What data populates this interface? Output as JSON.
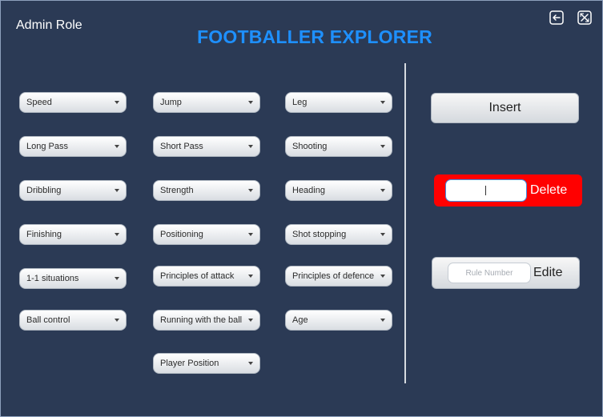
{
  "header": {
    "role_label": "Admin Role",
    "app_title": "FOOTBALLER EXPLORER"
  },
  "colors": {
    "background": "#2b3a55",
    "title": "#1e90ff",
    "delete_panel": "#ff0000"
  },
  "window_controls": {
    "logout_icon": "logout-icon",
    "close_icon": "close-x-icon"
  },
  "attributes": {
    "speed": "Speed",
    "jump": "Jump",
    "leg": "Leg",
    "long_pass": "Long Pass",
    "short_pass": "Short Pass",
    "shooting": "Shooting",
    "dribbling": "Dribbling",
    "strength": "Strength",
    "heading": "Heading",
    "finishing": "Finishing",
    "positioning": "Positioning",
    "shot_stopping": "Shot stopping",
    "one_v_one": "1-1 situations",
    "principles_attack": "Principles of attack",
    "principles_defence": "Principles of defence",
    "ball_control": "Ball control",
    "running_with_ball": "Running with the ball",
    "age": "Age",
    "player_position": "Player Position"
  },
  "actions": {
    "insert_label": "Insert",
    "delete_label": "Delete",
    "delete_input_value": "",
    "edit_label": "Edite",
    "rule_number_placeholder": "Rule Number",
    "rule_number_value": ""
  }
}
